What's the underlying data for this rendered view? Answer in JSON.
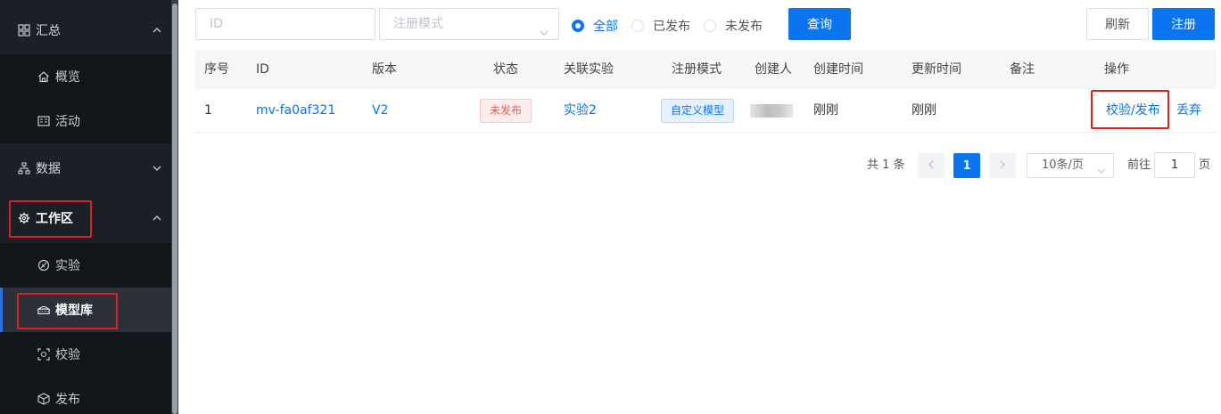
{
  "sidebar": {
    "summary": {
      "label": "汇总",
      "icon": "grid-icon",
      "expanded": true
    },
    "summary_items": [
      {
        "label": "概览",
        "icon": "home-icon"
      },
      {
        "label": "活动",
        "icon": "activity-card-icon"
      }
    ],
    "data_group": {
      "label": "数据",
      "icon": "data-tree-icon",
      "expanded": false
    },
    "workspace": {
      "label": "工作区",
      "icon": "gear-chip-icon",
      "expanded": true
    },
    "workspace_items": [
      {
        "label": "实验",
        "icon": "experiment-icon"
      },
      {
        "label": "模型库",
        "icon": "model-library-icon",
        "active": true
      },
      {
        "label": "校验",
        "icon": "scan-icon"
      },
      {
        "label": "发布",
        "icon": "cube-icon"
      }
    ]
  },
  "filters": {
    "id_placeholder": "ID",
    "mode_placeholder": "注册模式",
    "radios": [
      {
        "label": "全部",
        "checked": true
      },
      {
        "label": "已发布",
        "checked": false
      },
      {
        "label": "未发布",
        "checked": false
      }
    ],
    "query_label": "查询",
    "refresh_label": "刷新",
    "register_label": "注册"
  },
  "table": {
    "headers": [
      "序号",
      "ID",
      "版本",
      "状态",
      "关联实验",
      "注册模式",
      "创建人",
      "创建时间",
      "更新时间",
      "备注",
      "操作"
    ],
    "rows": [
      {
        "index": "1",
        "id": "mv-fa0af321",
        "version": "V2",
        "status": "未发布",
        "experiment": "实验2",
        "mode": "自定义模型",
        "creator": "",
        "created": "刚刚",
        "updated": "刚刚",
        "remark": "",
        "action_primary": "校验/发布",
        "action_secondary": "丢弃"
      }
    ]
  },
  "pagination": {
    "total_text": "共 1 条",
    "current_page": "1",
    "page_size": "10条/页",
    "goto_label": "前往",
    "goto_value": "1",
    "page_suffix": "页"
  },
  "colors": {
    "primary": "#0b74f0",
    "sidebar_bg": "#1b2027",
    "highlight": "#e02020",
    "status_red": "#f05a5a"
  }
}
